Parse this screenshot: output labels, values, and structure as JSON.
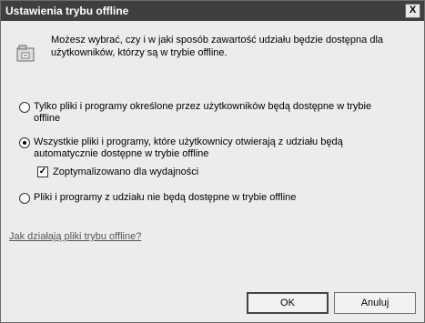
{
  "window": {
    "title": "Ustawienia trybu offline",
    "close_label": "X"
  },
  "description": "Możesz wybrać, czy i w jaki sposób zawartość udziału będzie dostępna dla użytkowników, którzy są w trybie offline.",
  "options": [
    {
      "label": "Tylko pliki i programy określone przez użytkowników będą dostępne w trybie offline",
      "selected": false
    },
    {
      "label": "Wszystkie pliki i programy, które użytkownicy otwierają z udziału będą automatycznie dostępne w trybie offline",
      "selected": true
    },
    {
      "label": "Pliki i programy z udziału nie będą dostępne w trybie offline",
      "selected": false
    }
  ],
  "optimize": {
    "label": "Zoptymalizowano dla wydajności",
    "checked": true
  },
  "help_link": "Jak działają pliki trybu offline?",
  "buttons": {
    "ok": "OK",
    "cancel": "Anuluj"
  }
}
